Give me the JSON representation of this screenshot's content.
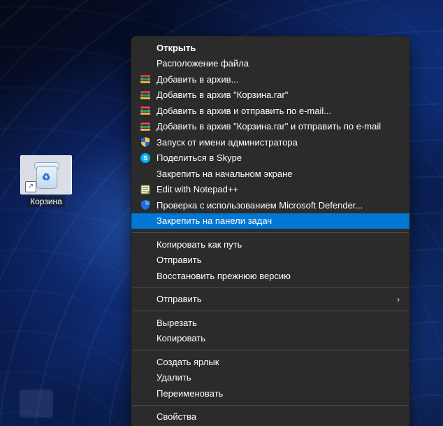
{
  "desktop": {
    "icon": {
      "label": "Корзина",
      "glyph": "♻",
      "shortcut_arrow": "↗"
    }
  },
  "context_menu": {
    "groups": [
      [
        {
          "key": "open",
          "label": "Открыть",
          "bold": true,
          "icon": null
        },
        {
          "key": "file-location",
          "label": "Расположение файла",
          "icon": null
        },
        {
          "key": "add-archive",
          "label": "Добавить в архив...",
          "icon": "winrar"
        },
        {
          "key": "add-archive-rar",
          "label": "Добавить в архив \"Корзина.rar\"",
          "icon": "winrar"
        },
        {
          "key": "archive-email",
          "label": "Добавить в архив и отправить по e-mail...",
          "icon": "winrar"
        },
        {
          "key": "archive-rar-email",
          "label": "Добавить в архив \"Корзина.rar\" и отправить по e-mail",
          "icon": "winrar"
        },
        {
          "key": "run-as-admin",
          "label": "Запуск от имени администратора",
          "icon": "shield-yb"
        },
        {
          "key": "share-skype",
          "label": "Поделиться в Skype",
          "icon": "skype"
        },
        {
          "key": "pin-start",
          "label": "Закрепить на начальном экране",
          "icon": null
        },
        {
          "key": "edit-npp",
          "label": "Edit with Notepad++",
          "icon": "npp"
        },
        {
          "key": "defender-scan",
          "label": "Проверка с использованием Microsoft Defender...",
          "icon": "defender"
        },
        {
          "key": "pin-taskbar",
          "label": "Закрепить на панели задач",
          "icon": null,
          "highlight": true
        }
      ],
      [
        {
          "key": "copy-as-path",
          "label": "Копировать как путь",
          "icon": null
        },
        {
          "key": "send1",
          "label": "Отправить",
          "icon": null
        },
        {
          "key": "restore-version",
          "label": "Восстановить прежнюю версию",
          "icon": null
        }
      ],
      [
        {
          "key": "send-to",
          "label": "Отправить",
          "icon": null,
          "submenu": true
        }
      ],
      [
        {
          "key": "cut",
          "label": "Вырезать",
          "icon": null
        },
        {
          "key": "copy",
          "label": "Копировать",
          "icon": null
        }
      ],
      [
        {
          "key": "create-shortcut",
          "label": "Создать ярлык",
          "icon": null
        },
        {
          "key": "delete",
          "label": "Удалить",
          "icon": null
        },
        {
          "key": "rename",
          "label": "Переименовать",
          "icon": null
        }
      ],
      [
        {
          "key": "properties",
          "label": "Свойства",
          "icon": null
        }
      ]
    ],
    "arrow_glyph": "›"
  }
}
